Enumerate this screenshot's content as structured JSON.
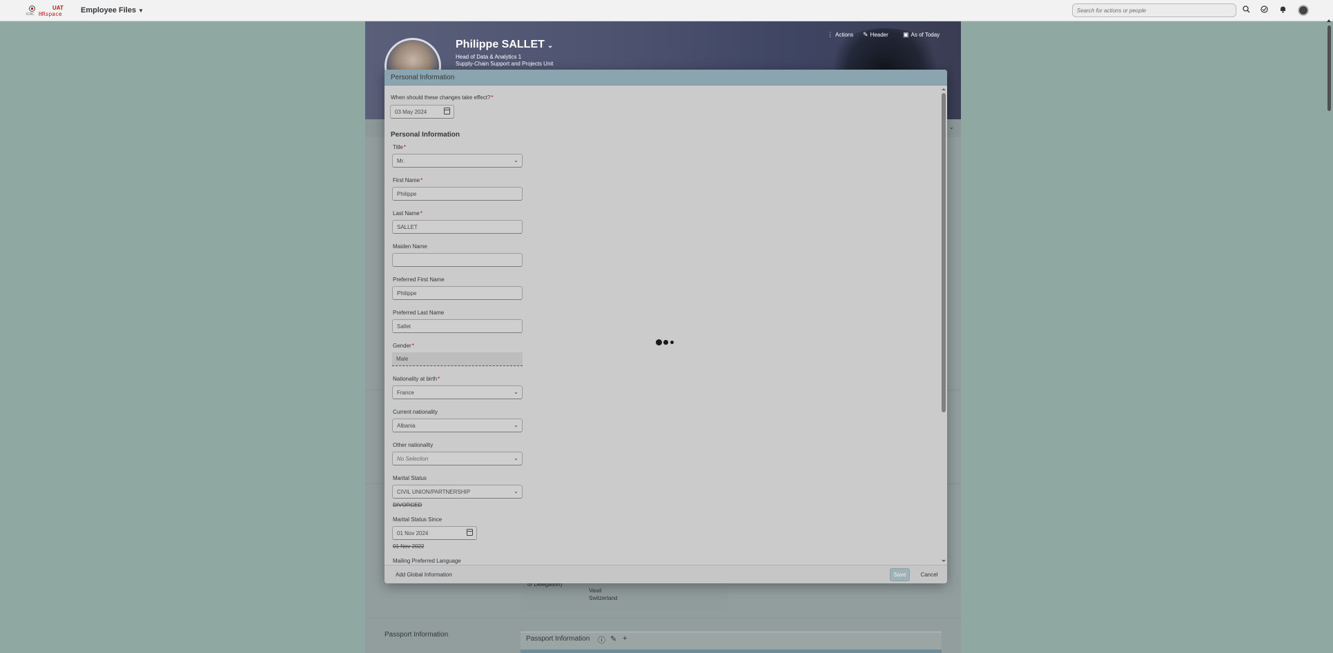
{
  "shell": {
    "logo_uat": "UAT",
    "logo_name": "HRspace",
    "logo_org": "ICRC",
    "app_title": "Employee Files",
    "search_placeholder": "Search for actions or people",
    "icons": [
      "search-icon",
      "approvals-icon",
      "notifications-icon",
      "user-avatar"
    ]
  },
  "profile": {
    "name": "Philippe SALLET",
    "position": "Head of Data & Analytics 1",
    "unit": "Supply-Chain Support and Projects Unit",
    "actions": [
      {
        "label": "Actions",
        "icon": "more-icon"
      },
      {
        "label": "Header",
        "icon": "edit-icon"
      },
      {
        "label": "As of Today",
        "icon": "calendar-icon"
      }
    ],
    "background_text": {
      "delegation": "or Delegation)",
      "address_lines": [
        "Vaud",
        "Switzerland"
      ]
    },
    "passport_section_label": "Passport Information",
    "passport_card_title": "Passport Information"
  },
  "dialog": {
    "title": "Personal Information",
    "effective_date_label": "When should these changes take effect?",
    "effective_date": "03 May 2024",
    "section_title": "Personal Information",
    "fields": {
      "title": {
        "label": "Title",
        "value": "Mr."
      },
      "first_name": {
        "label": "First Name",
        "value": "Philippe"
      },
      "last_name": {
        "label": "Last Name",
        "value": "SALLET"
      },
      "maiden_name": {
        "label": "Maiden Name",
        "value": ""
      },
      "preferred_first_name": {
        "label": "Preferred First Name",
        "value": "Philippe"
      },
      "preferred_last_name": {
        "label": "Preferred Last Name",
        "value": "Sallet"
      },
      "gender": {
        "label": "Gender",
        "value": "Male"
      },
      "nationality_birth": {
        "label": "Nationality at birth",
        "value": "France"
      },
      "current_nationality": {
        "label": "Current nationality",
        "value": "Albania"
      },
      "other_nationality": {
        "label": "Other nationality",
        "value": "No Selection"
      },
      "marital_status": {
        "label": "Marital Status",
        "value": "CIVIL UNION/PARTNERSHIP",
        "previous": "DIVORCED"
      },
      "marital_status_since": {
        "label": "Marital Status Since",
        "value": "01 Nov 2024",
        "previous": "01 Nov 2022"
      },
      "mailing_language": {
        "label": "Mailing Preferred Language"
      }
    },
    "footer": {
      "add_global": "Add Global Information",
      "save": "Save",
      "cancel": "Cancel"
    }
  },
  "colors": {
    "page_bg": "#8fa8a2",
    "dialog_header": "#8aa4b0",
    "required": "#cc0000",
    "brand": "#b51b1b"
  }
}
